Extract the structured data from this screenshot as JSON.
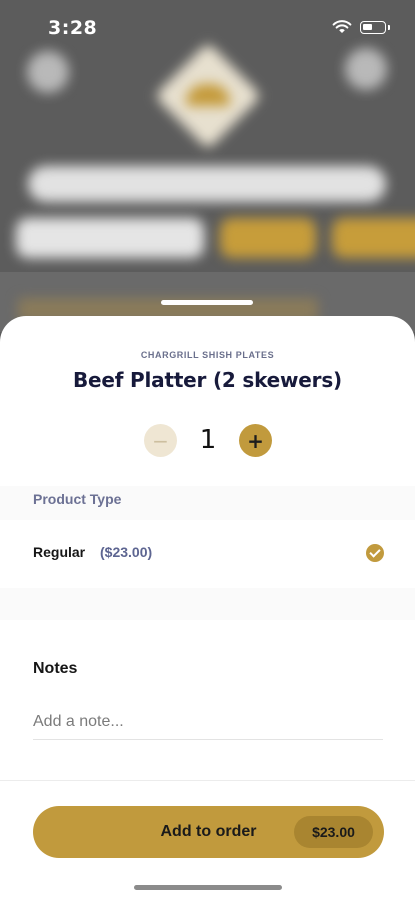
{
  "status_bar": {
    "time": "3:28"
  },
  "item": {
    "category": "CHARGRILL SHISH PLATES",
    "title": "Beef Platter (2 skewers)"
  },
  "quantity": {
    "value": "1",
    "minus_symbol": "−",
    "plus_symbol": "+"
  },
  "product_type": {
    "label": "Product Type",
    "options": [
      {
        "name": "Regular",
        "price": "($23.00)",
        "selected": true
      }
    ]
  },
  "notes": {
    "label": "Notes",
    "placeholder": "Add a note...",
    "value": ""
  },
  "footer": {
    "add_label": "Add to order",
    "total": "$23.00"
  },
  "colors": {
    "accent": "#c19a3d",
    "accent_dark": "#a98530",
    "title": "#171a3b",
    "muted_blue": "#5d6591"
  },
  "icons": [
    "wifi-icon",
    "battery-icon",
    "check-icon",
    "minus-icon",
    "plus-icon"
  ]
}
